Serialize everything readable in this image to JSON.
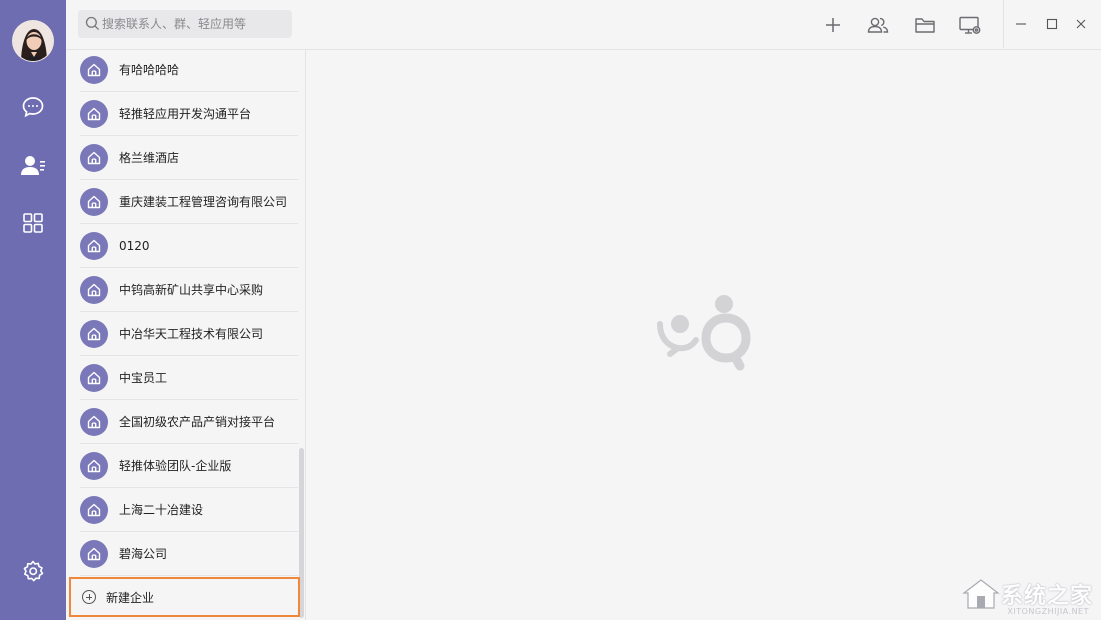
{
  "search": {
    "placeholder": "搜索联系人、群、轻应用等"
  },
  "rail": {
    "items": [
      {
        "icon": "chat-icon"
      },
      {
        "icon": "contacts-icon"
      },
      {
        "icon": "apps-grid-icon"
      }
    ],
    "settings_icon": "gear-icon"
  },
  "toolbar": {
    "icons": [
      "plus-icon",
      "group-icon",
      "folder-icon",
      "screen-share-icon"
    ],
    "window": [
      "minimize-icon",
      "maximize-icon",
      "close-icon"
    ]
  },
  "companies": [
    {
      "name": "有哈哈哈哈"
    },
    {
      "name": "轻推轻应用开发沟通平台"
    },
    {
      "name": "格兰维酒店"
    },
    {
      "name": "重庆建装工程管理咨询有限公司"
    },
    {
      "name": "0120"
    },
    {
      "name": "中钨高新矿山共享中心采购"
    },
    {
      "name": "中冶华天工程技术有限公司"
    },
    {
      "name": "中宝员工"
    },
    {
      "name": "全国初级农产品产销对接平台"
    },
    {
      "name": "轻推体验团队-企业版"
    },
    {
      "name": "上海二十冶建设"
    },
    {
      "name": "碧海公司"
    }
  ],
  "new_company": {
    "label": "新建企业"
  },
  "watermark": {
    "text": "系统之家",
    "sub": "XITONGZHIJIA.NET"
  },
  "colors": {
    "rail": "#6f6db2",
    "item_icon": "#7a78b8",
    "highlight": "#f0883b"
  }
}
